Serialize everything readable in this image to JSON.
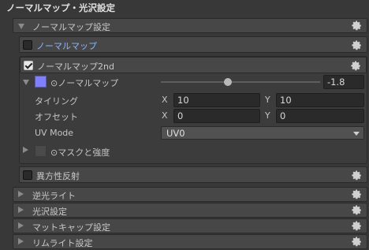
{
  "title": "ノーマルマップ・光沢設定",
  "sections": {
    "normal_settings": "ノーマルマップ設定",
    "normal_map": "ノーマルマップ",
    "normal_map_2nd": "ノーマルマップ2nd",
    "anisotropic": "異方性反射",
    "backlight": "逆光ライト",
    "gloss": "光沢設定",
    "matcap": "マットキャップ設定",
    "rimlight": "リムライト設定"
  },
  "normal2nd": {
    "texture_label": "⊙ノーマルマップ",
    "slider_value": "-1.8",
    "slider_fraction": 0.42,
    "tiling_label": "タイリング",
    "offset_label": "オフセット",
    "x": "X",
    "y": "Y",
    "tiling_x": "10",
    "tiling_y": "10",
    "offset_x": "0",
    "offset_y": "0",
    "uv_mode_label": "UV Mode",
    "uv_mode_value": "UV0",
    "mask_label": "⊙マスクと強度",
    "texture_color": "#8080ff"
  },
  "icons": {
    "gear": "gear-icon",
    "expand": "triangle-icon"
  }
}
